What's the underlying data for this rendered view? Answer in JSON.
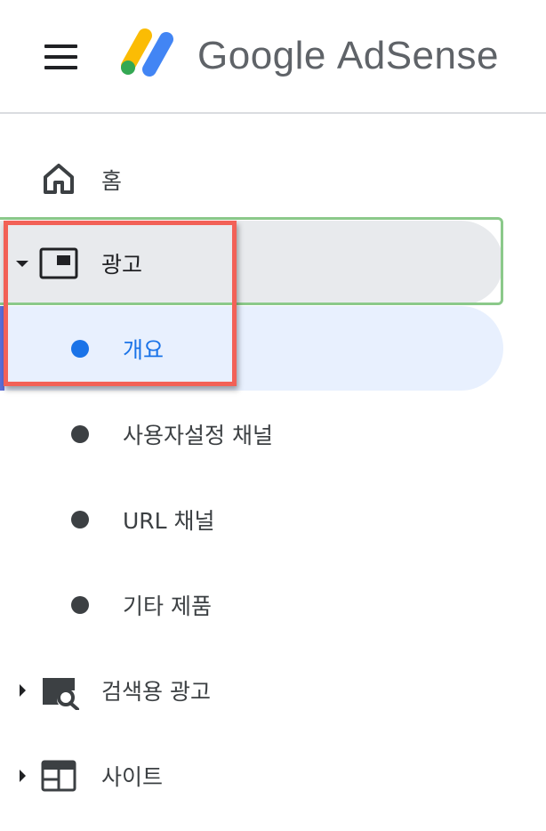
{
  "header": {
    "brand_google": "Google",
    "brand_product": "AdSense"
  },
  "colors": {
    "active_text": "#1a73e8",
    "selected_bg": "#e8f0fe",
    "parent_bg": "#e8eaed",
    "highlight_box": "#f26157",
    "outline": "#8bc98a"
  },
  "nav": {
    "home": {
      "label": "홈",
      "icon": "home-icon"
    },
    "ads": {
      "label": "광고",
      "icon": "ad-unit-icon",
      "expanded": true,
      "children": [
        {
          "label": "개요",
          "selected": true
        },
        {
          "label": "사용자설정 채널"
        },
        {
          "label": "URL 채널"
        },
        {
          "label": "기타 제품"
        }
      ]
    },
    "search_ads": {
      "label": "검색용 광고",
      "icon": "search-ads-icon",
      "expanded": false
    },
    "sites": {
      "label": "사이트",
      "icon": "sites-icon",
      "expanded": false
    }
  }
}
